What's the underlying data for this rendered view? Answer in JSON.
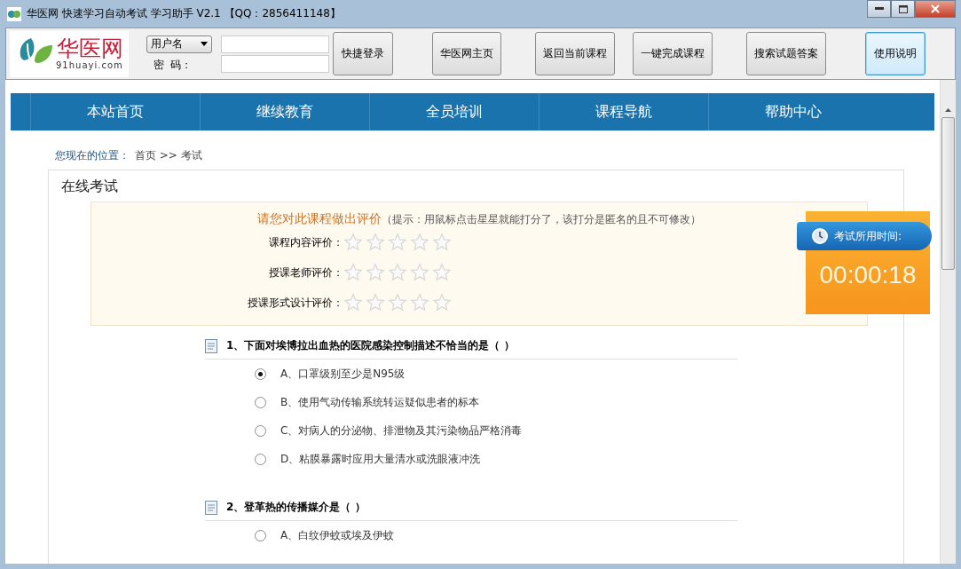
{
  "window": {
    "title": "华医网 快速学习自动考试 学习助手 V2.1 【QQ：2856411148】"
  },
  "toolbar": {
    "logo_name": "华医网",
    "logo_url": "91huayi.com",
    "account_type": "用户名",
    "password_label": "密  码：",
    "buttons": [
      {
        "label": "快捷登录",
        "focused": false
      },
      {
        "label": "华医网主页",
        "focused": false
      },
      {
        "label": "返回当前课程",
        "focused": false
      },
      {
        "label": "一键完成课程",
        "focused": false
      },
      {
        "label": "搜索试题答案",
        "focused": false
      },
      {
        "label": "使用说明",
        "focused": true
      }
    ]
  },
  "nav": [
    "本站首页",
    "继续教育",
    "全员培训",
    "课程导航",
    "帮助中心"
  ],
  "breadcrumb": {
    "label": "您现在的位置：",
    "path": "首页 >> 考试"
  },
  "exam": {
    "title": "在线考试",
    "rating": {
      "heading": "请您对此课程做出评价",
      "hint": "（提示：用鼠标点击星星就能打分了，该打分是匿名的且不可修改）",
      "items": [
        {
          "label": "课程内容评价：",
          "stars": 0
        },
        {
          "label": "授课老师评价：",
          "stars": 0
        },
        {
          "label": "授课形式设计评价：",
          "stars": 0
        }
      ]
    },
    "timer": {
      "label": "考试所用时间:",
      "value": "00:00:18"
    },
    "questions": [
      {
        "text": "1、下面对埃博拉出血热的医院感染控制描述不恰当的是（  ）",
        "options": [
          {
            "text": "A、口罩级别至少是N95级",
            "selected": true
          },
          {
            "text": "B、使用气动传输系统转运疑似患者的标本",
            "selected": false
          },
          {
            "text": "C、对病人的分泌物、排泄物及其污染物品严格消毒",
            "selected": false
          },
          {
            "text": "D、粘膜暴露时应用大量清水或洗眼液冲洗",
            "selected": false
          }
        ]
      },
      {
        "text": "2、登革热的传播媒介是（  ）",
        "options": [
          {
            "text": "A、白纹伊蚊或埃及伊蚊",
            "selected": false
          }
        ]
      }
    ]
  }
}
